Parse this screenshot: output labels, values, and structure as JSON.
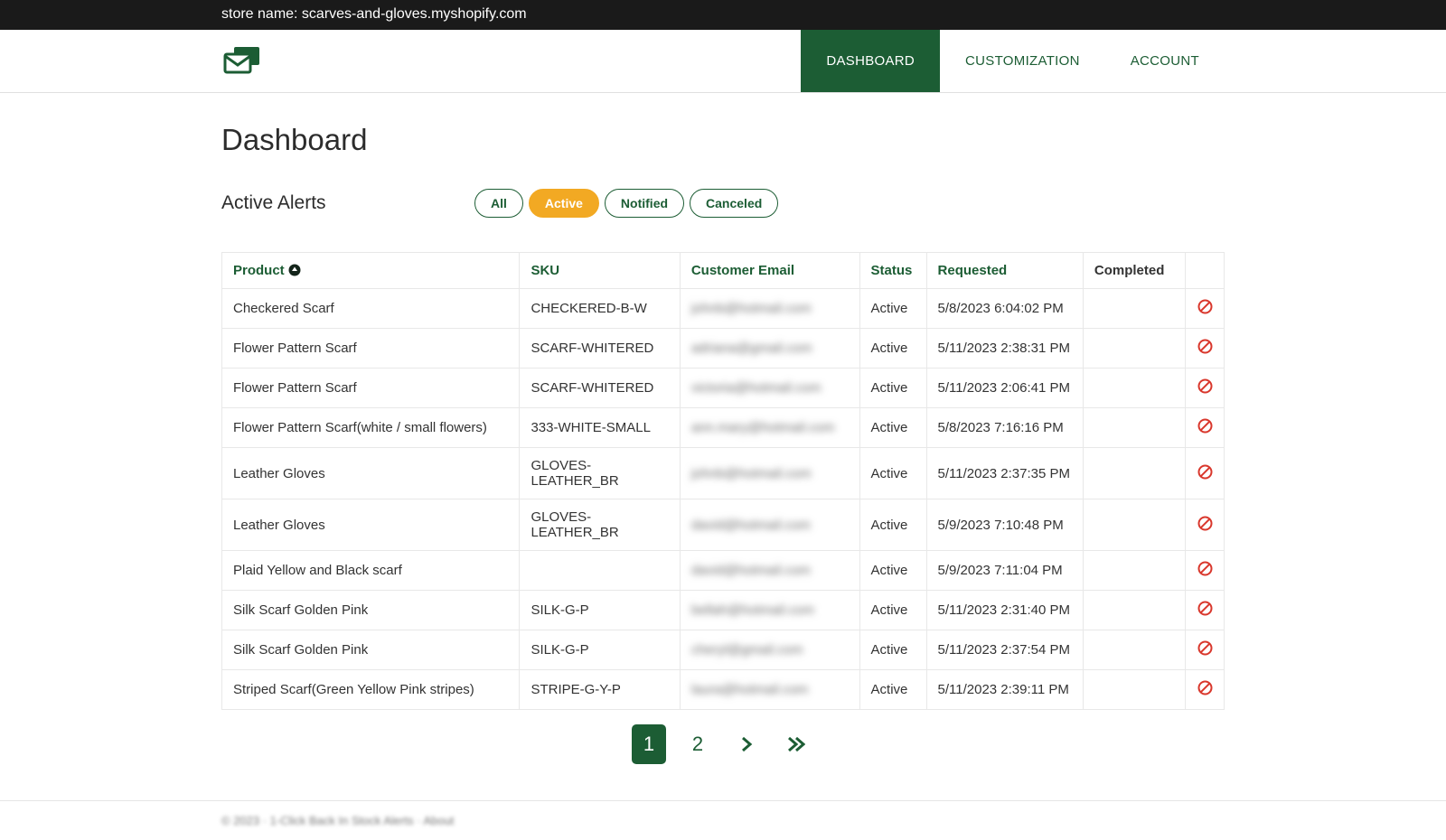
{
  "topbar": {
    "label": "store name: scarves-and-gloves.myshopify.com"
  },
  "nav": {
    "items": [
      {
        "label": "DASHBOARD",
        "active": true
      },
      {
        "label": "CUSTOMIZATION",
        "active": false
      },
      {
        "label": "ACCOUNT",
        "active": false
      }
    ]
  },
  "page": {
    "title": "Dashboard",
    "section_label": "Active Alerts"
  },
  "filters": {
    "options": [
      {
        "label": "All",
        "active": false
      },
      {
        "label": "Active",
        "active": true
      },
      {
        "label": "Notified",
        "active": false
      },
      {
        "label": "Canceled",
        "active": false
      }
    ]
  },
  "table": {
    "columns": {
      "product": "Product",
      "sku": "SKU",
      "email": "Customer Email",
      "status": "Status",
      "requested": "Requested",
      "completed": "Completed"
    },
    "rows": [
      {
        "product": "Checkered Scarf",
        "sku": "CHECKERED-B-W",
        "email": "johnb@hotmail.com",
        "status": "Active",
        "requested": "5/8/2023 6:04:02 PM",
        "completed": ""
      },
      {
        "product": "Flower Pattern Scarf",
        "sku": "SCARF-WHITERED",
        "email": "adriana@gmail.com",
        "status": "Active",
        "requested": "5/11/2023 2:38:31 PM",
        "completed": ""
      },
      {
        "product": "Flower Pattern Scarf",
        "sku": "SCARF-WHITERED",
        "email": "victoria@hotmail.com",
        "status": "Active",
        "requested": "5/11/2023 2:06:41 PM",
        "completed": ""
      },
      {
        "product": "Flower Pattern Scarf(white / small flowers)",
        "sku": "333-WHITE-SMALL",
        "email": "ann.mary@hotmail.com",
        "status": "Active",
        "requested": "5/8/2023 7:16:16 PM",
        "completed": ""
      },
      {
        "product": "Leather Gloves",
        "sku": "GLOVES-LEATHER_BR",
        "email": "johnb@hotmail.com",
        "status": "Active",
        "requested": "5/11/2023 2:37:35 PM",
        "completed": ""
      },
      {
        "product": "Leather Gloves",
        "sku": "GLOVES-LEATHER_BR",
        "email": "david@hotmail.com",
        "status": "Active",
        "requested": "5/9/2023 7:10:48 PM",
        "completed": ""
      },
      {
        "product": "Plaid Yellow and Black scarf",
        "sku": "",
        "email": "david@hotmail.com",
        "status": "Active",
        "requested": "5/9/2023 7:11:04 PM",
        "completed": ""
      },
      {
        "product": "Silk Scarf Golden Pink",
        "sku": "SILK-G-P",
        "email": "bellah@hotmail.com",
        "status": "Active",
        "requested": "5/11/2023 2:31:40 PM",
        "completed": ""
      },
      {
        "product": "Silk Scarf Golden Pink",
        "sku": "SILK-G-P",
        "email": "cheryl@gmail.com",
        "status": "Active",
        "requested": "5/11/2023 2:37:54 PM",
        "completed": ""
      },
      {
        "product": "Striped Scarf(Green Yellow Pink stripes)",
        "sku": "STRIPE-G-Y-P",
        "email": "laura@hotmail.com",
        "status": "Active",
        "requested": "5/11/2023 2:39:11 PM",
        "completed": ""
      }
    ]
  },
  "pagination": {
    "pages": [
      "1",
      "2"
    ],
    "current": "1"
  },
  "footer": {
    "text": "© 2023 · 1-Click Back In Stock Alerts · About"
  },
  "colors": {
    "brand": "#1c5d34",
    "accent": "#f2a923",
    "danger": "#d9372c"
  }
}
